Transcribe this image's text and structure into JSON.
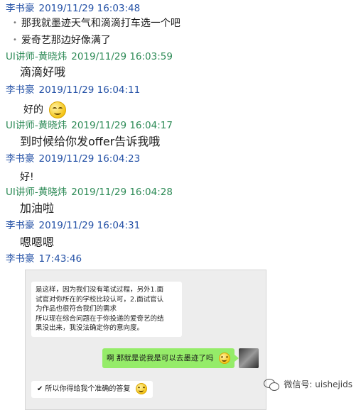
{
  "conversation": [
    {
      "sender": "李书豪",
      "time": "2019/11/29 16:03:48",
      "role": "student"
    },
    {
      "bullet_lines": [
        "那我就墨迹天气和滴滴打车选一个吧",
        "爱奇艺那边好像满了"
      ]
    },
    {
      "sender": "UI讲师-黄晓炜",
      "time": "2019/11/29 16:03:59",
      "role": "teacher"
    },
    {
      "text": "滴滴好哦"
    },
    {
      "sender": "李书豪",
      "time": "2019/11/29 16:04:11",
      "role": "student"
    },
    {
      "text": "好的",
      "emoji": "smile-emoji"
    },
    {
      "sender": "UI讲师-黄晓炜",
      "time": "2019/11/29 16:04:17",
      "role": "teacher"
    },
    {
      "text": "到时候给你发offer告诉我哦"
    },
    {
      "sender": "李书豪",
      "time": "2019/11/29 16:04:23",
      "role": "student"
    },
    {
      "text": "好!"
    },
    {
      "sender": "UI讲师-黄晓炜",
      "time": "2019/11/29 16:04:28",
      "role": "teacher"
    },
    {
      "text": "加油啦"
    },
    {
      "sender": "李书豪",
      "time": "2019/11/29 16:04:31",
      "role": "student"
    },
    {
      "text": "嗯嗯嗯"
    },
    {
      "sender": "李书豪",
      "time": "17:43:46",
      "role": "student"
    }
  ],
  "screenshot": {
    "white_message_lines": [
      "是这样，因为我们没有笔试过程，另外1.面",
      "试官对你所在的学校比较认可，2.面试官认",
      "为作品也很符合我们的需求",
      "所以现在综合问题在于你投递的爱奇艺的结",
      "果没出来，我没法确定你的意向度。"
    ],
    "green_message": "啊  那就是说我是可以去墨迹了吗",
    "bottom_message": "所以你得给我个准确的答复",
    "check_symbol": "✔"
  },
  "watermark": {
    "label": "微信号:",
    "value": "uishejids"
  },
  "colors": {
    "student": "#2451a6",
    "teacher": "#2e8b57",
    "green_bubble": "#95ec69"
  }
}
